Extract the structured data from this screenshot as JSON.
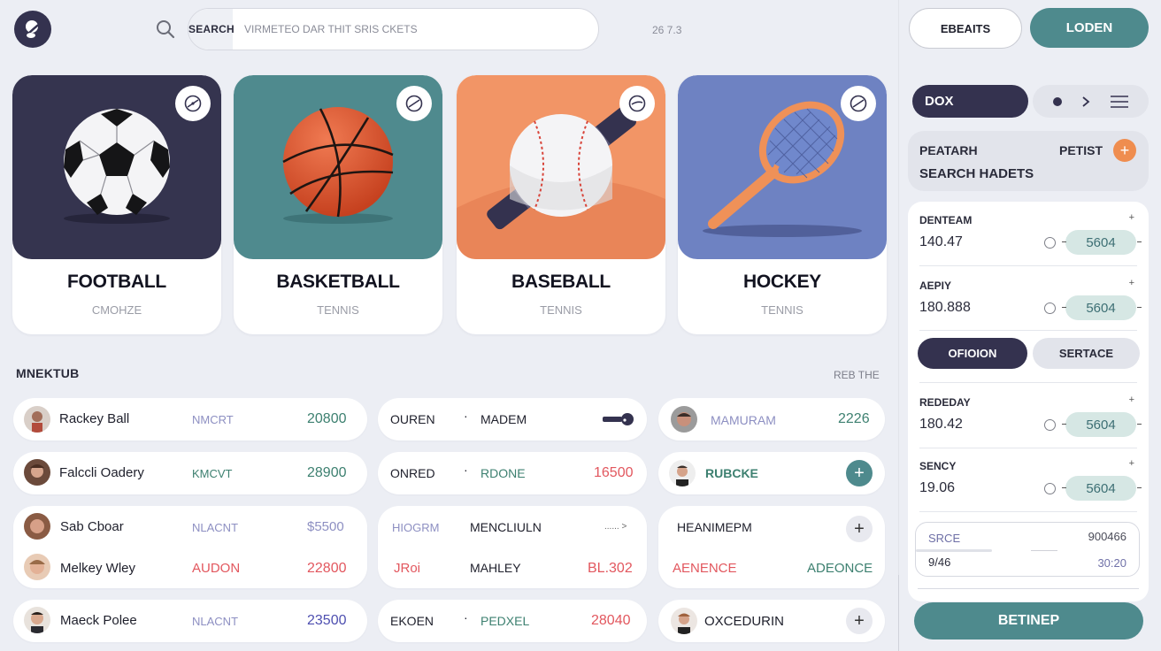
{
  "header": {
    "search_label": "SEARCH",
    "search_placeholder": "VIRMETEO DAR THIT SRIS CKETS",
    "meta": "26 7.3",
    "btn_outline": "EBEAITS",
    "btn_primary": "LODEN"
  },
  "sports": [
    {
      "title": "FOOTBALL",
      "subtitle": "CMOHZE",
      "color": "#35344f",
      "icon": "soccer-ball-icon"
    },
    {
      "title": "BASKETBALL",
      "subtitle": "TENNIS",
      "color": "#4f8a8e",
      "icon": "basketball-icon"
    },
    {
      "title": "BASEBALL",
      "subtitle": "TENNIS",
      "color": "#f29566",
      "icon": "baseball-icon"
    },
    {
      "title": "HOCKEY",
      "subtitle": "TENNIS",
      "color": "#6e82c2",
      "icon": "tennis-racket-icon"
    }
  ],
  "section": {
    "title": "MNEKTUB",
    "link": "REB THE"
  },
  "players_col1": [
    {
      "name": "Rackey Ball",
      "tag": "NMCRT",
      "value": "20800"
    },
    {
      "name": "Falccli Oadery",
      "tag": "KMCVT",
      "value": "28900"
    },
    {
      "name": "Sab Cboar",
      "tag": "NLACNT",
      "value": "$5500"
    },
    {
      "name": "Melkey Wley",
      "tag": "AUDON",
      "value": "22800"
    },
    {
      "name": "Maeck Polee",
      "tag": "NLACNT",
      "value": "23500"
    }
  ],
  "matches_col2": [
    {
      "left": "OUREN",
      "right": "MADEM",
      "value": ""
    },
    {
      "left": "ONRED",
      "right": "RDONE",
      "value": "16500"
    },
    {
      "left": "HIOGRM",
      "right": "MENCLIULN",
      "value": "...... >"
    },
    {
      "left": "JRoi",
      "right": "MAHLEY",
      "value": "BL.302"
    },
    {
      "left": "EKOEN",
      "right": "PEDXEL",
      "value": "28040"
    }
  ],
  "col3": [
    {
      "label": "MAMURAM",
      "value": "2226"
    },
    {
      "label": "RUBCKE"
    },
    {
      "label": "HEANIMEPM",
      "left": "AENENCE",
      "right": "ADEONCE"
    },
    {
      "label": "OXCEDURIN"
    }
  ],
  "panel": {
    "pill": "DOX",
    "promo_title": "PEATARH",
    "promo_right": "PETIST",
    "promo_sub": "SEARCH HADETS",
    "bets": [
      {
        "label": "DENTEAM",
        "value": "140.47",
        "odds": "5604"
      },
      {
        "label": "AEPIY",
        "value": "180.888",
        "odds": "5604"
      },
      {
        "label": "REDEDAY",
        "value": "180.42",
        "odds": "5604"
      },
      {
        "label": "SENCY",
        "value": "19.06",
        "odds": "5604"
      }
    ],
    "tab_active": "OFIOION",
    "tab_inactive": "SERTACE",
    "summary": {
      "k1": "SRCE",
      "v1": "900466",
      "k2": "9/46",
      "v2": "30:20"
    },
    "cta": "BETINEP"
  }
}
